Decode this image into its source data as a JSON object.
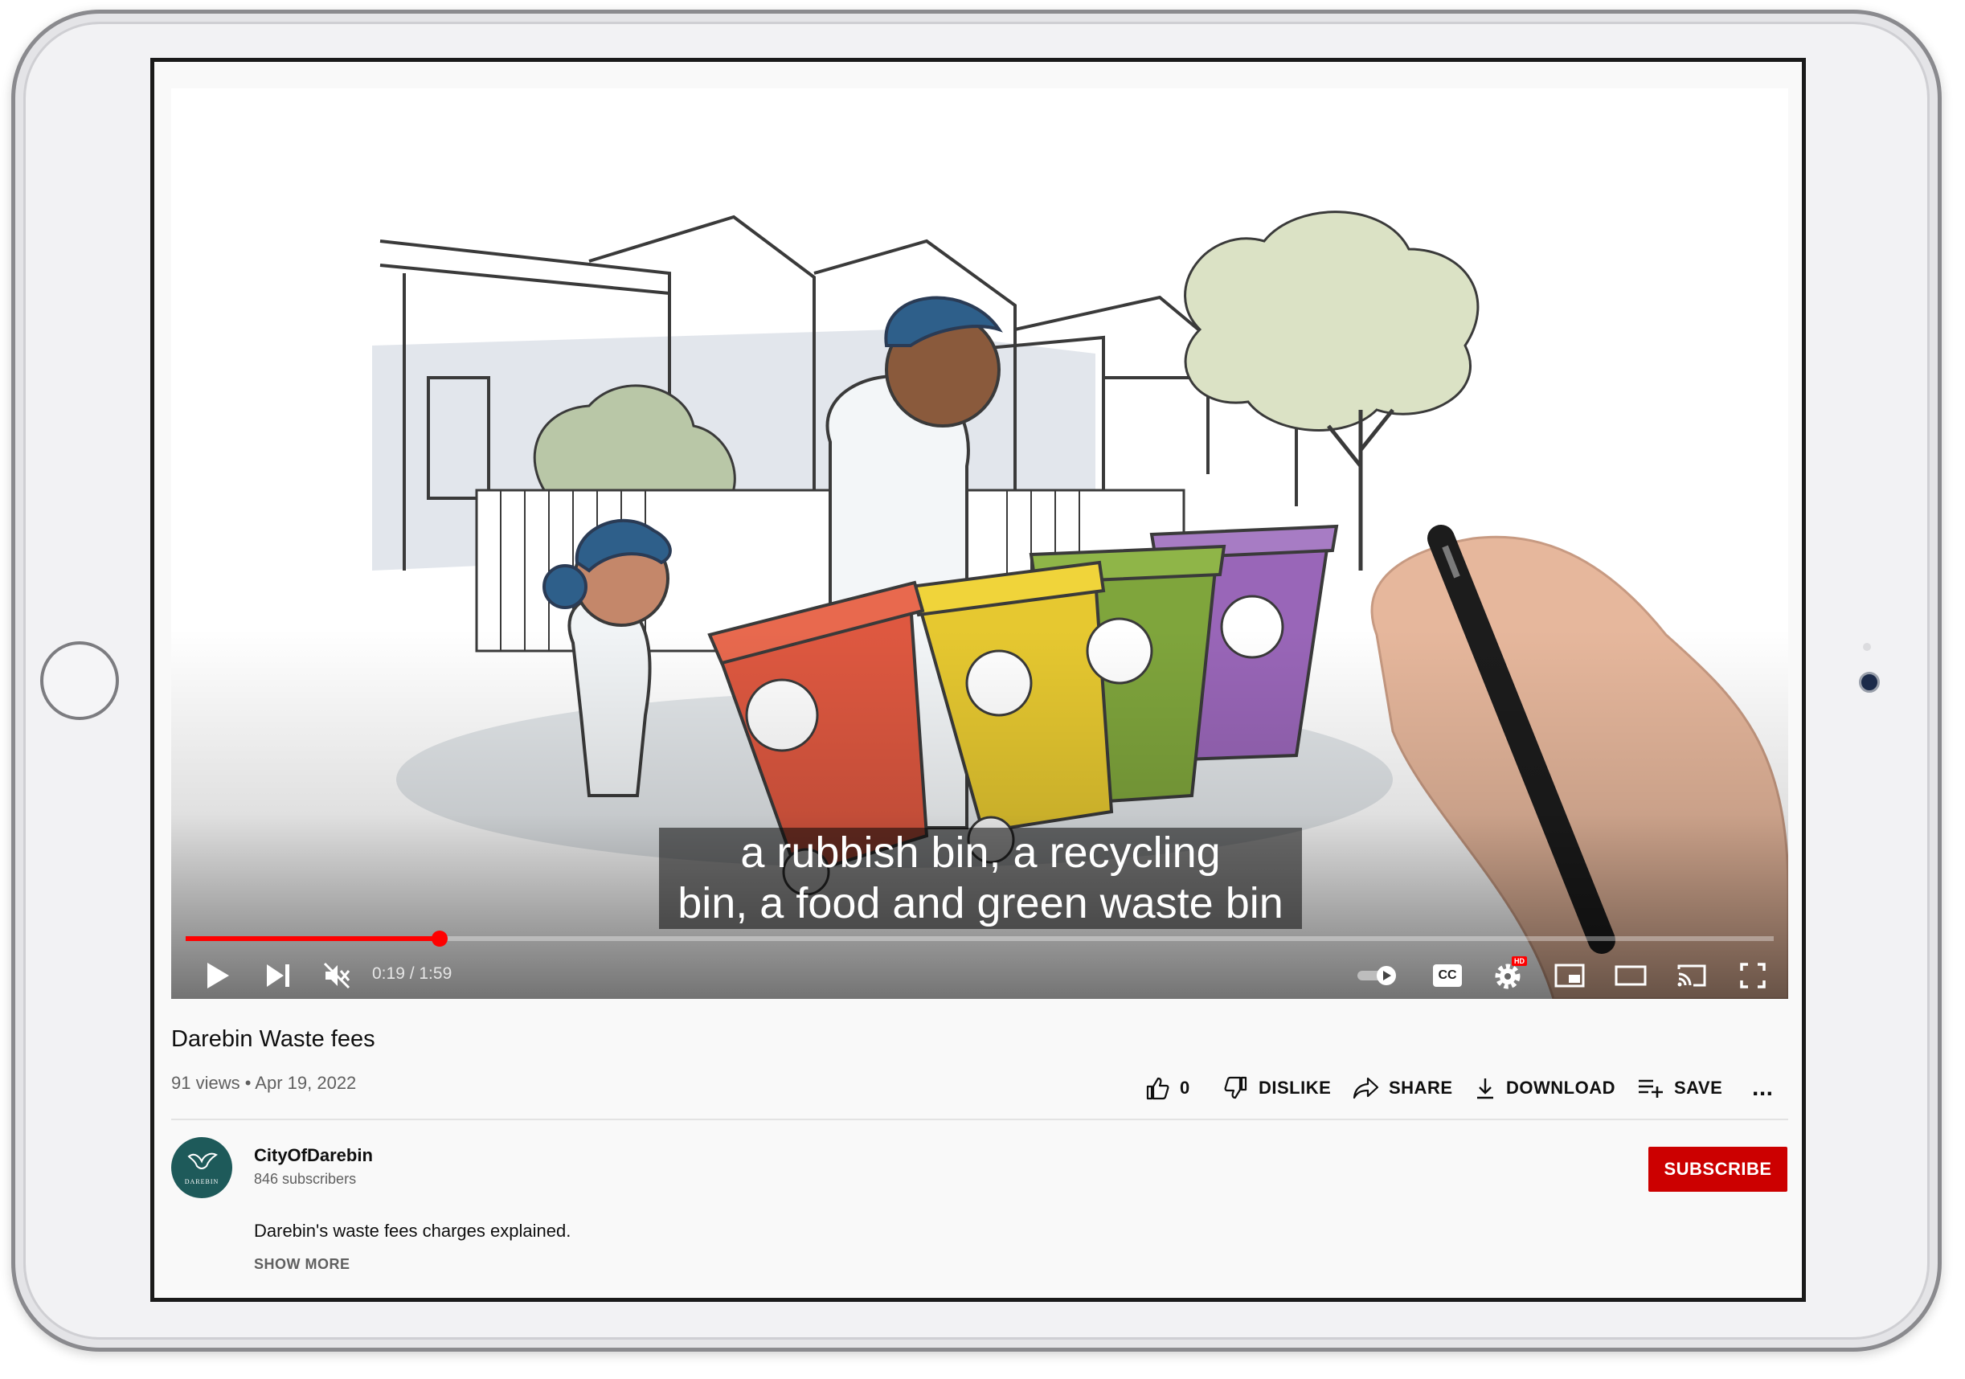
{
  "player": {
    "captions": [
      "a rubbish bin, a recycling",
      "bin, a food and green waste bin"
    ],
    "time_display": "0:19 / 1:59",
    "progress": 0.16,
    "accent": "#ff0000",
    "icons": [
      "play-icon",
      "next-icon",
      "mute-icon",
      "autoplay-toggle-icon",
      "captions-icon",
      "settings-icon",
      "miniplayer-icon",
      "theater-icon",
      "cast-icon",
      "fullscreen-icon"
    ],
    "settings_badge": "HD",
    "cc_label": "CC"
  },
  "video": {
    "title": "Darebin Waste fees",
    "meta": "91 views • Apr 19, 2022"
  },
  "actions": {
    "like_count": "0",
    "dislike": "DISLIKE",
    "share": "SHARE",
    "download": "DOWNLOAD",
    "save": "SAVE",
    "more": "..."
  },
  "channel": {
    "name": "CityOfDarebin",
    "subscribers": "846 subscribers",
    "subscribe": "SUBSCRIBE",
    "subscribe_color": "#cc0000",
    "logo_text": "DAREBIN"
  },
  "description": {
    "text": "Darebin's waste fees charges explained.",
    "show_more": "SHOW MORE"
  }
}
